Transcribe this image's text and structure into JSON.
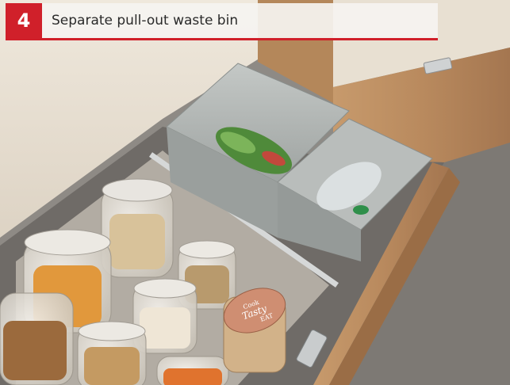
{
  "caption": {
    "number": "4",
    "text": "Separate pull-out waste bin"
  },
  "jar_lid": {
    "line1": "Cook",
    "line2": "Tasty",
    "line3": "EAT"
  },
  "colors": {
    "accent_red": "#d0202a",
    "wood": "#b98a5e",
    "bin_grey": "#a9aeac",
    "cabinet_cream": "#e9e1d4"
  }
}
